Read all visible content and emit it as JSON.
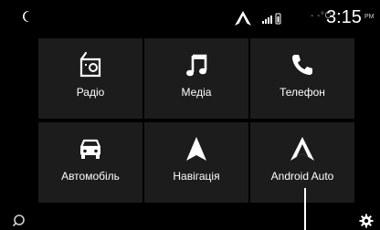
{
  "status_bar": {
    "moon_icon": "moon-icon",
    "nav_icon": "navigation-arrow-icon",
    "signal_icon": "signal-bars-icon",
    "temperature": "- -°C",
    "time": "3:15",
    "ampm": "PM"
  },
  "tiles": [
    {
      "label": "Радіо",
      "icon": "radio-icon"
    },
    {
      "label": "Медіа",
      "icon": "music-note-icon"
    },
    {
      "label": "Телефон",
      "icon": "phone-icon"
    },
    {
      "label": "Автомобіль",
      "icon": "car-icon"
    },
    {
      "label": "Навігація",
      "icon": "navigation-arrow-icon"
    },
    {
      "label": "Android Auto",
      "icon": "android-auto-icon"
    }
  ],
  "bottom": {
    "left_icon": "voice-search-icon",
    "right_icon": "settings-gear-icon"
  },
  "colors": {
    "background": "#000000",
    "tile": "#1c1c1c",
    "text": "#ffffff",
    "muted": "#9a9a9a"
  }
}
